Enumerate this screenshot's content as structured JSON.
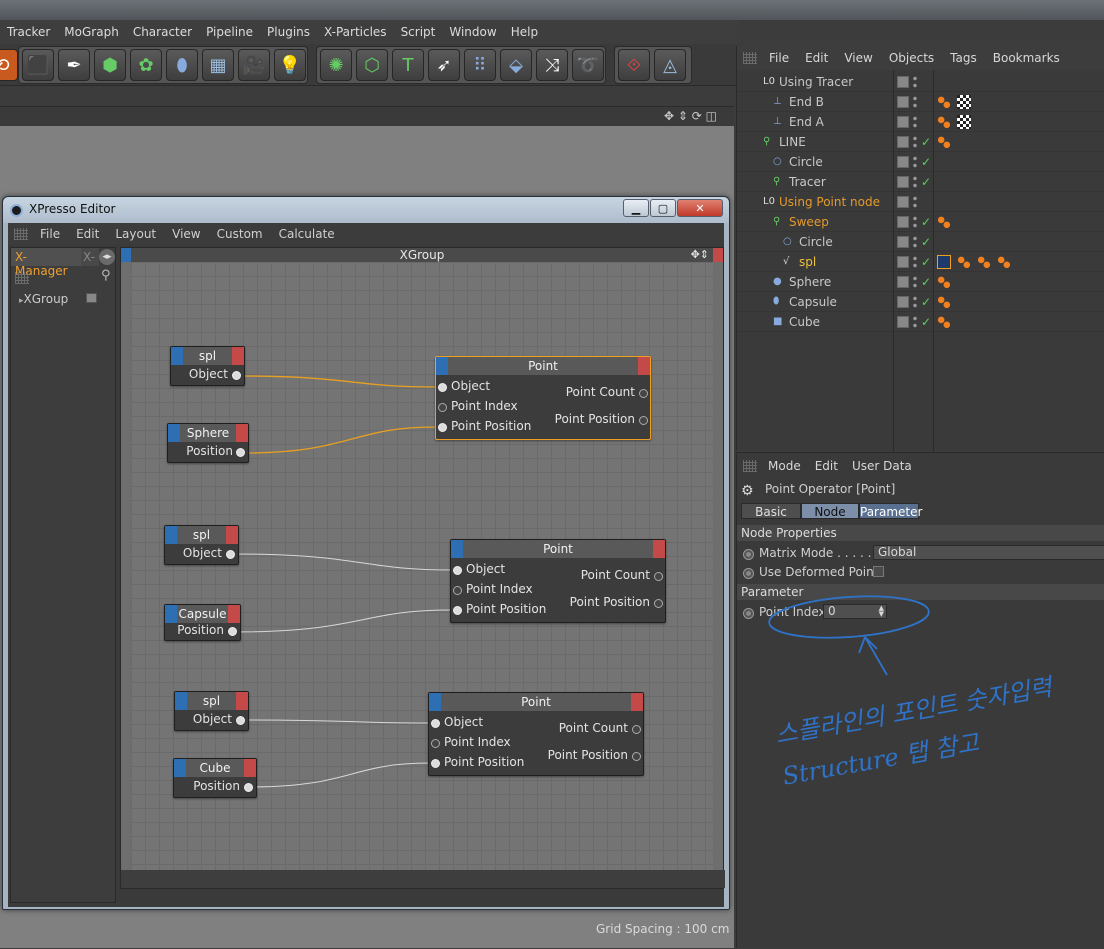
{
  "main_menu": [
    "Tracker",
    "MoGraph",
    "Character",
    "Pipeline",
    "Plugins",
    "X-Particles",
    "Script",
    "Window",
    "Help"
  ],
  "toolbar_icons": [
    "cube-icon",
    "pen-icon",
    "subdivision-icon",
    "cloner-icon",
    "deformer-icon",
    "floor-icon",
    "camera-icon",
    "light-icon",
    "mograph-icon",
    "motext-icon",
    "text-icon",
    "hair-icon",
    "tracer-icon",
    "effector-icon",
    "random-icon",
    "spline-icon",
    "render-icon",
    "scene-icon"
  ],
  "xpresso": {
    "window_title": "XPresso Editor",
    "menu": [
      "File",
      "Edit",
      "Layout",
      "View",
      "Custom",
      "Calculate"
    ],
    "manager_tab": "X-Manager",
    "manager_tab2": "X-",
    "manager_item": "XGroup",
    "graph_title": "XGroup",
    "grid_spacing": "Grid Spacing : 100 cm",
    "nodes": [
      {
        "title": "spl",
        "port": "Object"
      },
      {
        "title": "Sphere",
        "port": "Position"
      },
      {
        "title": "spl",
        "port": "Object"
      },
      {
        "title": "Capsule",
        "port": "Position"
      },
      {
        "title": "spl",
        "port": "Object"
      },
      {
        "title": "Cube",
        "port": "Position"
      }
    ],
    "point_node": {
      "title": "Point",
      "in_object": "Object",
      "in_index": "Point Index",
      "in_position": "Point Position",
      "out_count": "Point Count",
      "out_position": "Point Position"
    }
  },
  "object_manager": {
    "menu": [
      "File",
      "Edit",
      "View",
      "Objects",
      "Tags",
      "Bookmarks"
    ],
    "rows": [
      {
        "name": "Using Tracer",
        "color": "#c8c8c8"
      },
      {
        "name": "End B",
        "color": "#c8c8c8"
      },
      {
        "name": "End A",
        "color": "#c8c8c8"
      },
      {
        "name": "LINE",
        "color": "#c8c8c8"
      },
      {
        "name": "Circle",
        "color": "#c8c8c8"
      },
      {
        "name": "Tracer",
        "color": "#c8c8c8"
      },
      {
        "name": "Using Point node",
        "color": "#e49a2a"
      },
      {
        "name": "Sweep",
        "color": "#e49a2a"
      },
      {
        "name": "Circle",
        "color": "#c8c8c8"
      },
      {
        "name": "spl",
        "color": "#f0c040"
      },
      {
        "name": "Sphere",
        "color": "#c8c8c8"
      },
      {
        "name": "Capsule",
        "color": "#c8c8c8"
      },
      {
        "name": "Cube",
        "color": "#c8c8c8"
      }
    ]
  },
  "attribute_manager": {
    "menu": [
      "Mode",
      "Edit",
      "User Data"
    ],
    "title": "Point Operator [Point]",
    "tabs": [
      "Basic",
      "Node",
      "Parameter"
    ],
    "section_node": "Node Properties",
    "matrix_mode_label": "Matrix Mode . . . . . . .",
    "matrix_mode_value": "Global",
    "use_deformed_label": "Use Deformed Points",
    "section_param": "Parameter",
    "point_index_label": "Point Index",
    "point_index_value": "0",
    "handwritten_note": "스플라인의 포인트 숫자입력 Structure 탭 참고"
  }
}
